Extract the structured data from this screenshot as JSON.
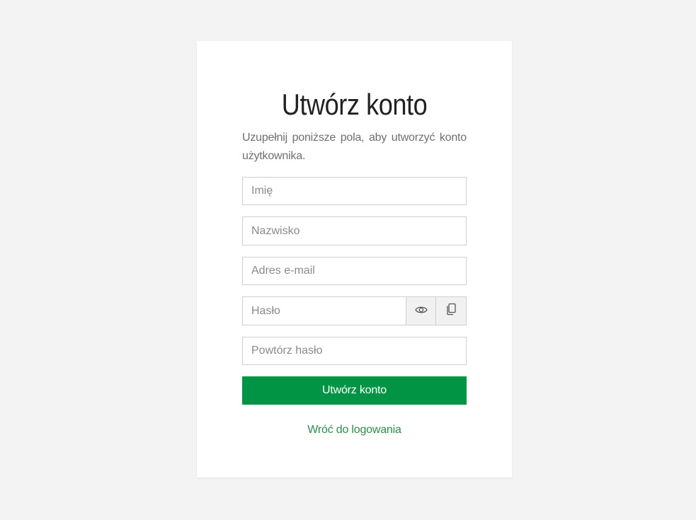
{
  "form": {
    "title": "Utwórz konto",
    "subtitle": "Uzupełnij poniższe pola, aby utworzyć konto użytkownika.",
    "first_name": {
      "placeholder": "Imię",
      "value": ""
    },
    "last_name": {
      "placeholder": "Nazwisko",
      "value": ""
    },
    "email": {
      "placeholder": "Adres e-mail",
      "value": ""
    },
    "password": {
      "placeholder": "Hasło",
      "value": "",
      "show_icon": "eye-icon",
      "copy_icon": "copy-icon"
    },
    "password_repeat": {
      "placeholder": "Powtórz hasło",
      "value": ""
    },
    "submit_label": "Utwórz konto",
    "back_link_label": "Wróć do logowania"
  },
  "colors": {
    "background": "#f3f3f3",
    "card": "#ffffff",
    "primary_button": "#009444",
    "link": "#2e8a4d",
    "field_border": "#cfcfcf",
    "addon_background": "#f1f1f1"
  }
}
